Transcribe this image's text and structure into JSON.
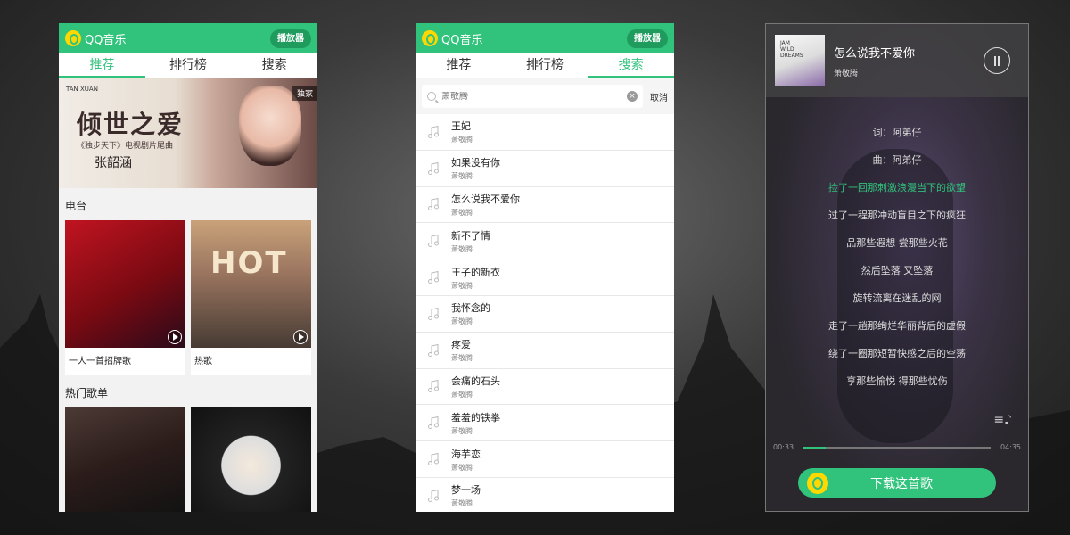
{
  "app": {
    "logo_text": "QQ音乐",
    "player_button": "播放器"
  },
  "tabs": [
    "推荐",
    "排行榜",
    "搜索"
  ],
  "recommend": {
    "banner": {
      "badge": "独家",
      "brand": "TAN XUAN",
      "title": "倾世之爱",
      "subtitle": "《独步天下》电视剧片尾曲",
      "artist": "张韶涵"
    },
    "radio_title": "电台",
    "radio": [
      {
        "label": "一人一首招牌歌"
      },
      {
        "label": "热歌",
        "cover_text": "HOT"
      }
    ],
    "hot_title": "热门歌单"
  },
  "search": {
    "placeholder": "萧敬腾",
    "cancel": "取消",
    "results": [
      {
        "title": "王妃",
        "artist": "萧敬腾"
      },
      {
        "title": "如果没有你",
        "artist": "萧敬腾"
      },
      {
        "title": "怎么说我不爱你",
        "artist": "萧敬腾"
      },
      {
        "title": "新不了情",
        "artist": "萧敬腾"
      },
      {
        "title": "王子的新衣",
        "artist": "萧敬腾"
      },
      {
        "title": "我怀念的",
        "artist": "萧敬腾"
      },
      {
        "title": "疼爱",
        "artist": "萧敬腾"
      },
      {
        "title": "会痛的石头",
        "artist": "萧敬腾"
      },
      {
        "title": "羞羞的铁拳",
        "artist": "萧敬腾"
      },
      {
        "title": "海芋恋",
        "artist": "萧敬腾"
      },
      {
        "title": "梦一场",
        "artist": "萧敬腾"
      }
    ]
  },
  "player": {
    "album_text": "JAM WILD DREAMS",
    "title": "怎么说我不爱你",
    "artist": "萧敬腾",
    "lyrics": [
      "词：阿弟仔",
      "曲：阿弟仔",
      "捡了一回那刺激浪漫当下的欲望",
      "过了一程那冲动盲目之下的疯狂",
      "品那些遐想 尝那些火花",
      "然后坠落 又坠落",
      "旋转流离在迷乱的网",
      "走了一趟那绚烂华丽背后的虚假",
      "绕了一圈那短暂快感之后的空荡",
      "享那些愉悦 得那些忧伤"
    ],
    "active_lyric_index": 2,
    "current_time": "00:33",
    "total_time": "04:35",
    "progress": 0.12,
    "download_label": "下载这首歌"
  },
  "colors": {
    "accent": "#31c27c",
    "logo_yellow": "#ffd800"
  }
}
